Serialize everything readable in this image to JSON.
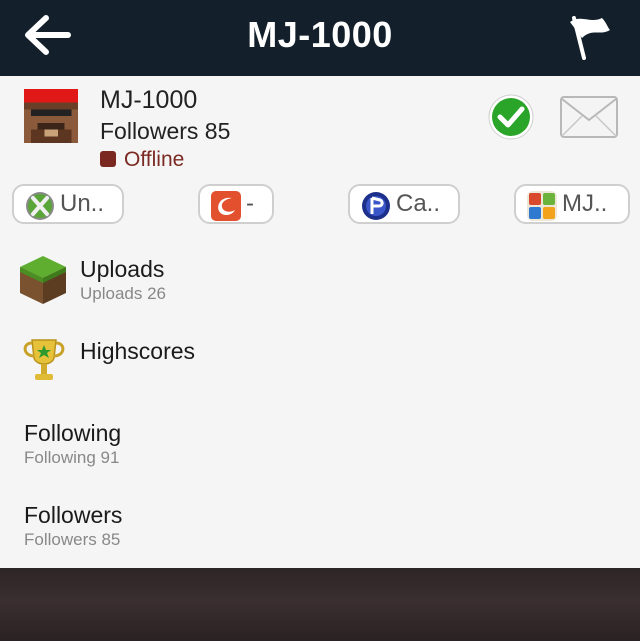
{
  "header": {
    "title": "MJ-1000"
  },
  "profile": {
    "name": "MJ-1000",
    "followers_text": "Followers 85",
    "status": "Offline",
    "status_color": "#7b2820"
  },
  "platforms": [
    {
      "label": "Un..",
      "icon": "xbox-icon"
    },
    {
      "label": "-",
      "icon": "origin-icon"
    },
    {
      "label": "Ca..",
      "icon": "playstation-icon"
    },
    {
      "label": "MJ..",
      "icon": "game-center-icon"
    }
  ],
  "menu": [
    {
      "title": "Uploads",
      "subtitle": "Uploads 26",
      "icon": "grass-block-icon"
    },
    {
      "title": "Highscores",
      "subtitle": "",
      "icon": "trophy-icon"
    },
    {
      "title": "Following",
      "subtitle": "Following 91"
    },
    {
      "title": "Followers",
      "subtitle": "Followers 85"
    }
  ],
  "colors": {
    "header_bg": "#13202b",
    "accent_green": "#2aa52a"
  }
}
